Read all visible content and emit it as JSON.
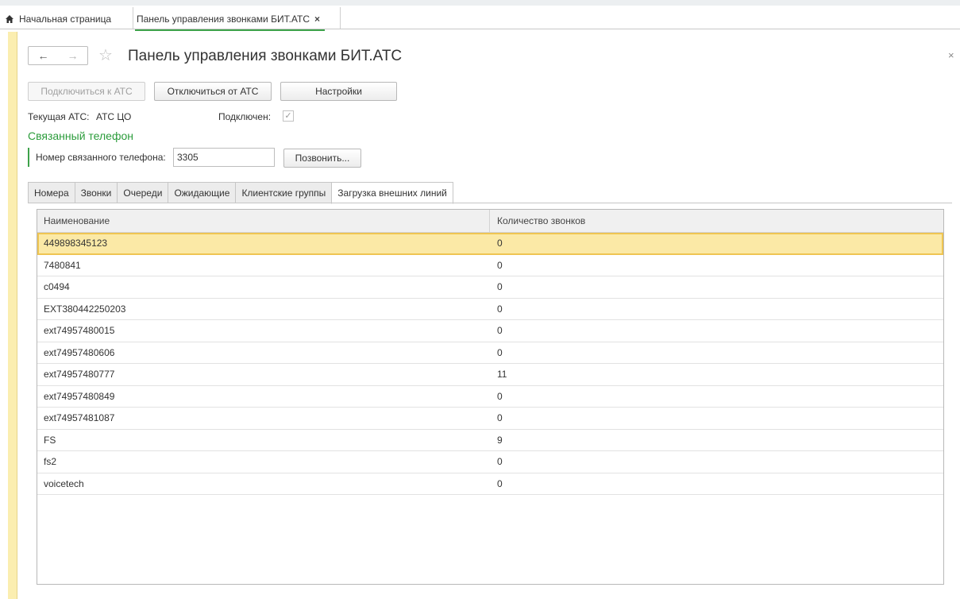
{
  "tabbar": {
    "home_label": "Начальная страница",
    "active_tab_label": "Панель управления звонками БИТ.АТС",
    "close_glyph": "×"
  },
  "header": {
    "back_glyph": "←",
    "forward_glyph": "→",
    "star_glyph": "☆",
    "title": "Панель управления звонками БИТ.АТС",
    "close_glyph": "×"
  },
  "toolbar": {
    "connect_label": "Подключиться к АТС",
    "disconnect_label": "Отключиться от АТС",
    "settings_label": "Настройки"
  },
  "status": {
    "current_pbx_label": "Текущая АТС:",
    "current_pbx_value": "АТС ЦО",
    "connected_label": "Подключен:",
    "connected_checked": true,
    "check_glyph": "✓"
  },
  "linked_phone": {
    "group_title": "Связанный телефон",
    "number_label": "Номер связанного телефона:",
    "number_value": "3305",
    "call_button_label": "Позвонить..."
  },
  "tabs": [
    {
      "label": "Номера",
      "active": false
    },
    {
      "label": "Звонки",
      "active": false
    },
    {
      "label": "Очереди",
      "active": false
    },
    {
      "label": "Ожидающие",
      "active": false
    },
    {
      "label": "Клиентские группы",
      "active": false
    },
    {
      "label": "Загрузка внешних линий",
      "active": true
    }
  ],
  "table": {
    "columns": [
      "Наименование",
      "Количество звонков"
    ],
    "rows": [
      {
        "name": "449898345123",
        "count": "0",
        "selected": true
      },
      {
        "name": "7480841",
        "count": "0"
      },
      {
        "name": "c0494",
        "count": "0"
      },
      {
        "name": "EXT380442250203",
        "count": "0"
      },
      {
        "name": "ext74957480015",
        "count": "0"
      },
      {
        "name": "ext74957480606",
        "count": "0"
      },
      {
        "name": "ext74957480777",
        "count": "11"
      },
      {
        "name": "ext74957480849",
        "count": "0"
      },
      {
        "name": "ext74957481087",
        "count": "0"
      },
      {
        "name": "FS",
        "count": "9"
      },
      {
        "name": "fs2",
        "count": "0"
      },
      {
        "name": "voicetech",
        "count": "0"
      }
    ]
  },
  "colors": {
    "accent_green": "#3da24a",
    "selection_fill": "#fbe9a6",
    "selection_border": "#efc552",
    "side_strip": "#fbeeb0"
  },
  "icons": {
    "home": "home-icon",
    "star": "star-icon",
    "checkbox": "checkmark-icon"
  }
}
